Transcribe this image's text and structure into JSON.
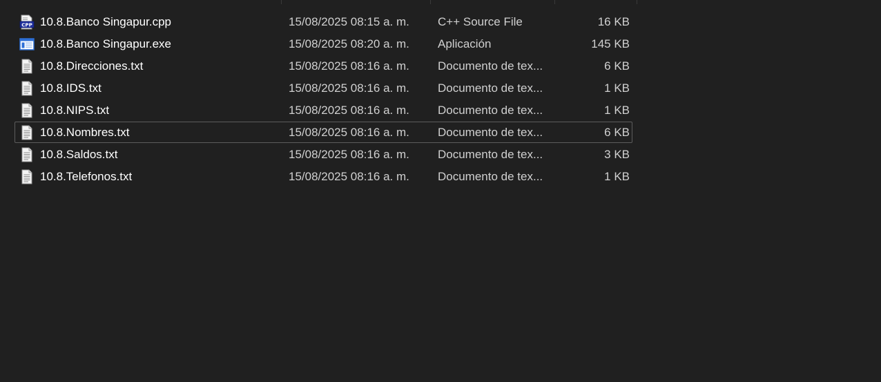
{
  "files": [
    {
      "name": "10.8.Banco Singapur.cpp",
      "date": "15/08/2025 08:15 a. m.",
      "type": "C++ Source File",
      "size": "16 KB",
      "icon": "cpp-file-icon",
      "selected": false
    },
    {
      "name": "10.8.Banco Singapur.exe",
      "date": "15/08/2025 08:20 a. m.",
      "type": "Aplicación",
      "size": "145 KB",
      "icon": "exe-file-icon",
      "selected": false
    },
    {
      "name": "10.8.Direcciones.txt",
      "date": "15/08/2025 08:16 a. m.",
      "type": "Documento de tex...",
      "size": "6 KB",
      "icon": "text-file-icon",
      "selected": false
    },
    {
      "name": "10.8.IDS.txt",
      "date": "15/08/2025 08:16 a. m.",
      "type": "Documento de tex...",
      "size": "1 KB",
      "icon": "text-file-icon",
      "selected": false
    },
    {
      "name": "10.8.NIPS.txt",
      "date": "15/08/2025 08:16 a. m.",
      "type": "Documento de tex...",
      "size": "1 KB",
      "icon": "text-file-icon",
      "selected": false
    },
    {
      "name": "10.8.Nombres.txt",
      "date": "15/08/2025 08:16 a. m.",
      "type": "Documento de tex...",
      "size": "6 KB",
      "icon": "text-file-icon",
      "selected": true
    },
    {
      "name": "10.8.Saldos.txt",
      "date": "15/08/2025 08:16 a. m.",
      "type": "Documento de tex...",
      "size": "3 KB",
      "icon": "text-file-icon",
      "selected": false
    },
    {
      "name": "10.8.Telefonos.txt",
      "date": "15/08/2025 08:16 a. m.",
      "type": "Documento de tex...",
      "size": "1 KB",
      "icon": "text-file-icon",
      "selected": false
    }
  ],
  "colors": {
    "background": "#202020",
    "text": "#ffffff",
    "secondary_text": "#d0d0d0",
    "selection_border": "#5d5d5d"
  }
}
